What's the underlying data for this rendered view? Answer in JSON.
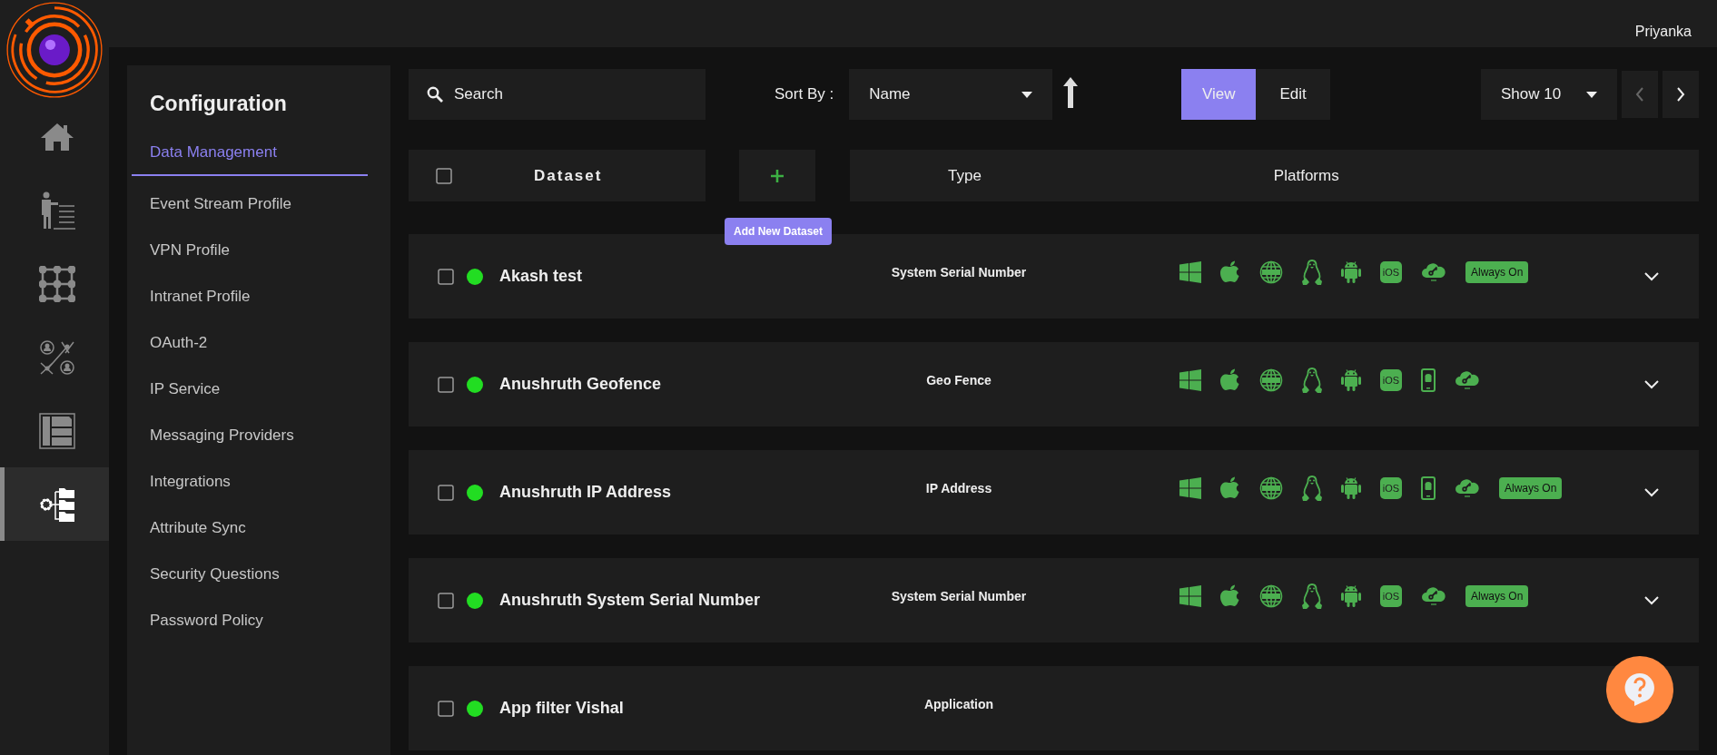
{
  "top_bar": {
    "user": "Priyanka"
  },
  "nav_rail": [
    {
      "kind": "home",
      "selected": false
    },
    {
      "kind": "presenter",
      "selected": false
    },
    {
      "kind": "grid",
      "selected": false
    },
    {
      "kind": "network",
      "selected": false
    },
    {
      "kind": "document",
      "selected": false
    },
    {
      "kind": "config",
      "selected": true
    }
  ],
  "config_menu": {
    "title": "Configuration",
    "items": [
      {
        "label": "Data Management",
        "selected": true
      },
      {
        "label": "Event Stream Profile",
        "selected": false
      },
      {
        "label": "VPN Profile",
        "selected": false
      },
      {
        "label": "Intranet Profile",
        "selected": false
      },
      {
        "label": "OAuth-2",
        "selected": false
      },
      {
        "label": "IP Service",
        "selected": false
      },
      {
        "label": "Messaging Providers",
        "selected": false
      },
      {
        "label": "Integrations",
        "selected": false
      },
      {
        "label": "Attribute Sync",
        "selected": false
      },
      {
        "label": "Security Questions",
        "selected": false
      },
      {
        "label": "Password Policy",
        "selected": false
      }
    ]
  },
  "toolbar": {
    "search": {
      "placeholder": "Search"
    },
    "sort_label": "Sort By :",
    "sort_value": "Name",
    "sort_ascending": true,
    "modes": [
      {
        "label": "View",
        "selected": true
      },
      {
        "label": "Edit",
        "selected": false
      }
    ],
    "page_size": "Show 10"
  },
  "table": {
    "select_all": {
      "checked": false
    },
    "columns": [
      "Dataset",
      "Type",
      "Platforms"
    ],
    "add_tooltip": "Add New Dataset",
    "rows": [
      {
        "checked": false,
        "active": true,
        "name": "Akash test",
        "type": "System Serial Number",
        "expanded": false,
        "platforms": [
          {
            "kind": "windows"
          },
          {
            "kind": "apple"
          },
          {
            "kind": "web"
          },
          {
            "kind": "linux"
          },
          {
            "kind": "android"
          },
          {
            "kind": "ios",
            "label": "iOS"
          },
          {
            "kind": "cloud"
          },
          {
            "kind": "badge",
            "label": "Always On"
          }
        ]
      },
      {
        "checked": false,
        "active": true,
        "name": "Anushruth Geofence",
        "type": "Geo Fence",
        "expanded": false,
        "platforms": [
          {
            "kind": "windows"
          },
          {
            "kind": "apple"
          },
          {
            "kind": "web"
          },
          {
            "kind": "linux"
          },
          {
            "kind": "android"
          },
          {
            "kind": "ios",
            "label": "iOS"
          },
          {
            "kind": "phone"
          },
          {
            "kind": "cloud"
          }
        ]
      },
      {
        "checked": false,
        "active": true,
        "name": "Anushruth IP Address",
        "type": "IP Address",
        "expanded": false,
        "platforms": [
          {
            "kind": "windows"
          },
          {
            "kind": "apple"
          },
          {
            "kind": "web"
          },
          {
            "kind": "linux"
          },
          {
            "kind": "android"
          },
          {
            "kind": "ios",
            "label": "iOS"
          },
          {
            "kind": "phone"
          },
          {
            "kind": "cloud"
          },
          {
            "kind": "badge",
            "label": "Always On"
          }
        ]
      },
      {
        "checked": false,
        "active": true,
        "name": "Anushruth System Serial Number",
        "type": "System Serial Number",
        "expanded": false,
        "platforms": [
          {
            "kind": "windows"
          },
          {
            "kind": "apple"
          },
          {
            "kind": "web"
          },
          {
            "kind": "linux"
          },
          {
            "kind": "android"
          },
          {
            "kind": "ios",
            "label": "iOS"
          },
          {
            "kind": "cloud"
          },
          {
            "kind": "badge",
            "label": "Always On"
          }
        ]
      },
      {
        "checked": false,
        "active": true,
        "name": "App filter Vishal",
        "type": "Application"
      }
    ]
  }
}
